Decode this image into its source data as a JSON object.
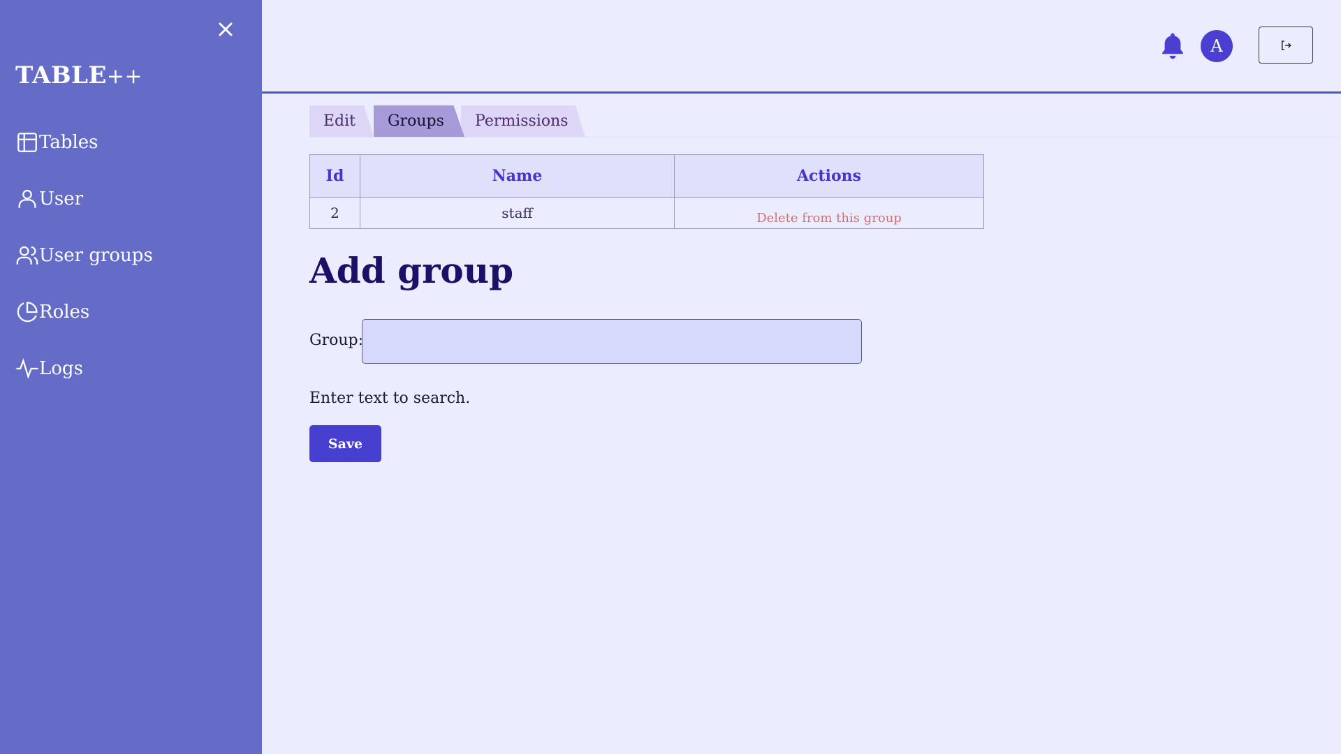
{
  "sidebar": {
    "brand": "TABLE",
    "brand_suffix": "++",
    "items": [
      {
        "label": "Tables",
        "icon": "table-icon"
      },
      {
        "label": "User",
        "icon": "user-icon"
      },
      {
        "label": "User groups",
        "icon": "users-icon"
      },
      {
        "label": "Roles",
        "icon": "pie-chart-icon"
      },
      {
        "label": "Logs",
        "icon": "activity-icon"
      }
    ]
  },
  "header": {
    "avatar_initial": "A"
  },
  "tabs": [
    "Edit",
    "Groups",
    "Permissions"
  ],
  "active_tab": "Groups",
  "table": {
    "columns": [
      "Id",
      "Name",
      "Actions"
    ],
    "rows": [
      {
        "id": "2",
        "name": "staff",
        "action": "Delete from this group"
      }
    ]
  },
  "form": {
    "heading": "Add group",
    "group_label": "Group:",
    "group_value": "",
    "hint": "Enter text to search.",
    "save_label": "Save"
  },
  "colors": {
    "sidebar": "#646cc8",
    "background": "#ebedfe",
    "accent": "#473fd0",
    "danger": "#e06a6a"
  }
}
